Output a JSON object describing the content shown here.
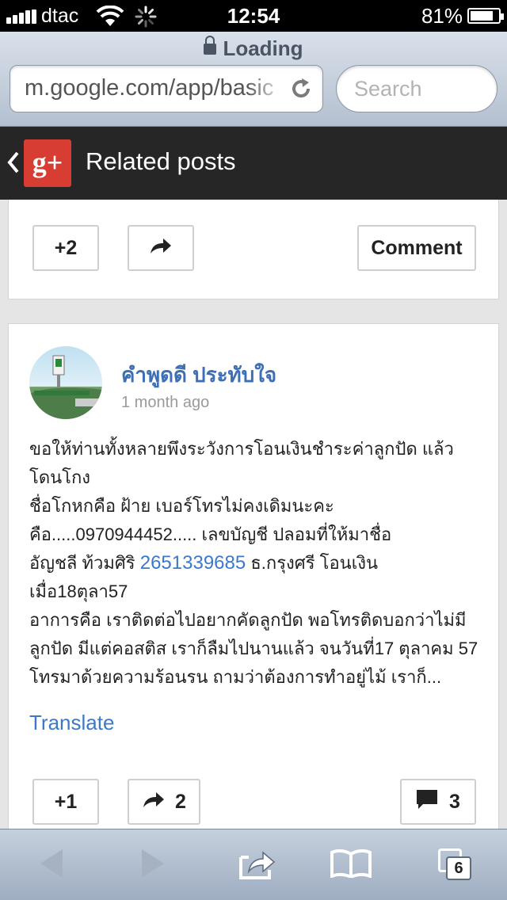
{
  "status_bar": {
    "carrier": "dtac",
    "time": "12:54",
    "battery_percent": "81%",
    "battery_level": 0.81,
    "signal_icon": "signal-bars-icon",
    "wifi_icon": "wifi-icon",
    "activity_icon": "loading-spinner-icon"
  },
  "browser": {
    "loading_label": "Loading",
    "url": "m.google.com/app/basic",
    "search_placeholder": "Search",
    "reload_icon": "reload-icon"
  },
  "app_header": {
    "logo_text": "g+",
    "title": "Related posts",
    "brand_color": "#d73d32"
  },
  "previous_post_actions": {
    "plus_label": "+2",
    "comment_label": "Comment",
    "share_icon": "share-arrow-icon"
  },
  "post": {
    "author": "คำพูดดี ประทับใจ",
    "time_ago": "1 month ago",
    "lines": {
      "l1": "ขอให้ท่านทั้งหลายพึงระวังการโอนเงินชำระค่าลูกปัด แล้วโดนโกง",
      "l2": "ชื่อโกหกคือ ฝ้าย  เบอร์โทรไม่คงเดิมนะคะ",
      "l3": "คือ.....0970944452..... เลขบัญชี ปลอมที่ให้มาชื่อ",
      "l4a": "อัญชลี ท้วมศิริ ",
      "account_number": "2651339685",
      "l4b": " ธ.กรุงศรี โอนเงิน",
      "l5": "เมื่อ18ตุลา57",
      "l6": "อาการคือ เราติดต่อไปอยากคัดลูกปัด พอโทรติดบอกว่าไม่มีลูกปัด มีแต่คอสติส เราก็ลืมไปนานแล้ว จนวันที่17 ตุลาคม 57 โทรมาด้วยความร้อนรน ถามว่าต้องการทำอยู่ไม้ เราก็..."
    },
    "translate_label": "Translate",
    "plus_label": "+1",
    "share_count": "2",
    "comment_count": "3",
    "link_color": "#3d78c9"
  },
  "toolbar": {
    "tabs_count": "6"
  }
}
